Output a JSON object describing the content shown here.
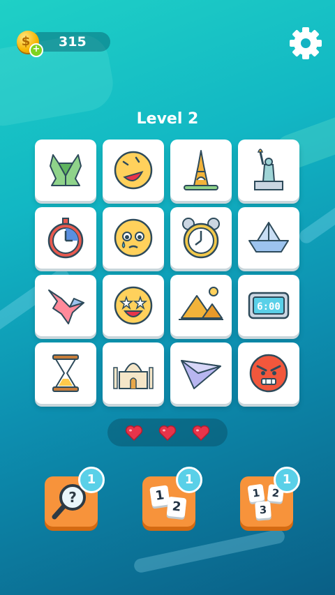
{
  "hud": {
    "coins": "315",
    "coin_symbol": "$",
    "add_symbol": "+"
  },
  "level_title": "Level 2",
  "grid": {
    "tiles": [
      {
        "icon": "origami-frog"
      },
      {
        "icon": "laughing-emoji"
      },
      {
        "icon": "eiffel-tower"
      },
      {
        "icon": "statue-of-liberty"
      },
      {
        "icon": "stopwatch"
      },
      {
        "icon": "crying-emoji"
      },
      {
        "icon": "alarm-clock"
      },
      {
        "icon": "paper-boat"
      },
      {
        "icon": "origami-crane"
      },
      {
        "icon": "star-eyes-emoji"
      },
      {
        "icon": "pyramids"
      },
      {
        "icon": "digital-clock"
      },
      {
        "icon": "hourglass"
      },
      {
        "icon": "taj-mahal"
      },
      {
        "icon": "paper-plane"
      },
      {
        "icon": "angry-emoji"
      }
    ]
  },
  "lives": {
    "count": 3
  },
  "boosters": {
    "hint": {
      "badge": "1",
      "icon": "magnifier-question-icon",
      "glyph": "?"
    },
    "swap_two": {
      "badge": "1",
      "icon": "two-tiles-icon",
      "tile1": "1",
      "tile2": "2"
    },
    "swap_three": {
      "badge": "1",
      "icon": "three-tiles-icon",
      "tile1": "1",
      "tile2": "2",
      "tile3": "3"
    }
  },
  "digital_clock_text": "6:00",
  "colors": {
    "accent_orange": "#f7933b",
    "badge_blue": "#5ad0e8",
    "heart_red": "#e8344a",
    "coin_gold": "#f6b400"
  }
}
